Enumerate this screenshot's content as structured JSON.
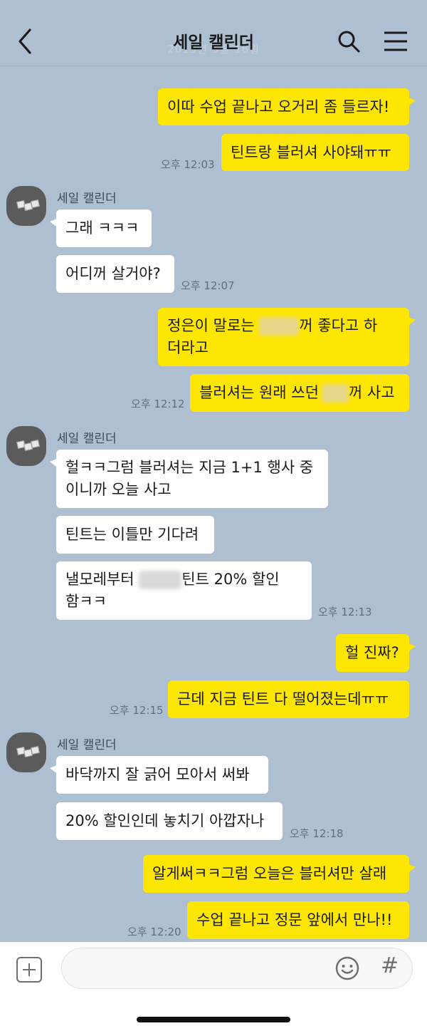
{
  "header": {
    "title": "세일 캘린더",
    "date_faded": "2019년 5월 16일"
  },
  "sender_name": "세일 캘린더",
  "messages": {
    "m1": "이따 수업 끝나고 오거리 좀 들르자!",
    "m2": "틴트랑 블러셔 사야돼ㅠㅠ",
    "t1": "오후 12:03",
    "m3": "그래 ㅋㅋㅋ",
    "m4": "어디꺼 살거야?",
    "t2": "오후 12:07",
    "m5_a": "정은이 말로는",
    "m5_b": "꺼 좋다고 하",
    "m5_c": "더라고",
    "m6_a": "블러셔는 원래 쓰던",
    "m6_b": "꺼 사고",
    "t3": "오후 12:12",
    "m7_a": "헐ㅋㅋ그럼 블러셔는 지금 1+1 행사 중",
    "m7_b": "이니까 오늘 사고",
    "m8": "틴트는 이틀만 기다려",
    "m9_a": "낼모레부터",
    "m9_b": "틴트 20% 할인",
    "m9_c": "함ㅋㅋ",
    "t4": "오후 12:13",
    "m10": "헐 진짜?",
    "m11": "근데 지금 틴트 다 떨어졌는데ㅠㅠ",
    "t5": "오후 12:15",
    "m12": "바닥까지 잘 긁어 모아서 써봐",
    "m13": "20% 할인인데 놓치기 아깝자나",
    "t6": "오후 12:18",
    "m14": "알게써ㅋㅋ그럼 오늘은 블러셔만 살래",
    "m15": "수업 끝나고 정문 앞에서 만나!!",
    "t7": "오후 12:20"
  },
  "composer": {
    "hash_label": "#"
  },
  "icons": [
    "back-icon",
    "search-icon",
    "menu-icon",
    "plus-icon",
    "emoji-icon",
    "hash-icon"
  ],
  "colors": {
    "background": "#aebfd1",
    "my_bubble": "#fde603",
    "their_bubble": "#ffffff"
  }
}
